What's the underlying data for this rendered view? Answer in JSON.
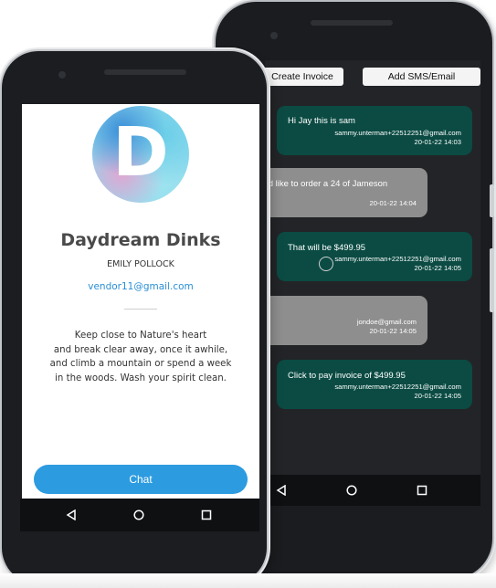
{
  "invoice_screen": {
    "create_invoice_label": "Create Invoice",
    "add_sms_email_label": "Add SMS/Email",
    "messages": [
      {
        "text": "Hi Jay this is sam",
        "sender": "sammy.unterman+22512251@gmail.com",
        "time": "20-01-22 14:03",
        "style": "outgoing"
      },
      {
        "text": ", I'd like to order a 24 of Jameson",
        "sender": "",
        "time": "20-01-22 14:04",
        "style": "incoming"
      },
      {
        "text": "That will be $499.95",
        "sender": "sammy.unterman+22512251@gmail.com",
        "time": "20-01-22 14:05",
        "style": "outgoing"
      },
      {
        "text": "",
        "sender": "jondoe@gmail.com",
        "time": "20-01-22 14:05",
        "style": "incoming"
      },
      {
        "text": "Click to pay invoice of $499.95",
        "sender": "sammy.unterman+22512251@gmail.com",
        "time": "20-01-22 14:05",
        "style": "outgoing"
      }
    ]
  },
  "profile_screen": {
    "logo_letter": "D",
    "business_name": "Daydream Dinks",
    "owner_name": "EMILY POLLOCK",
    "email": "vendor11@gmail.com",
    "bio_lines": [
      "Keep close to Nature's heart",
      "and break clear away, once it awhile,",
      "and climb a mountain or spend a week",
      "in the woods. Wash your spirit clean."
    ],
    "chat_button_label": "Chat"
  },
  "nav_icons": [
    "back-icon",
    "home-icon",
    "recents-icon"
  ],
  "colors": {
    "outgoing_bubble": "#0b4b43",
    "incoming_bubble": "#8e8e8e",
    "chat_button": "#2c9be0",
    "email_link": "#2a8fd6",
    "dark_background": "#222427"
  }
}
